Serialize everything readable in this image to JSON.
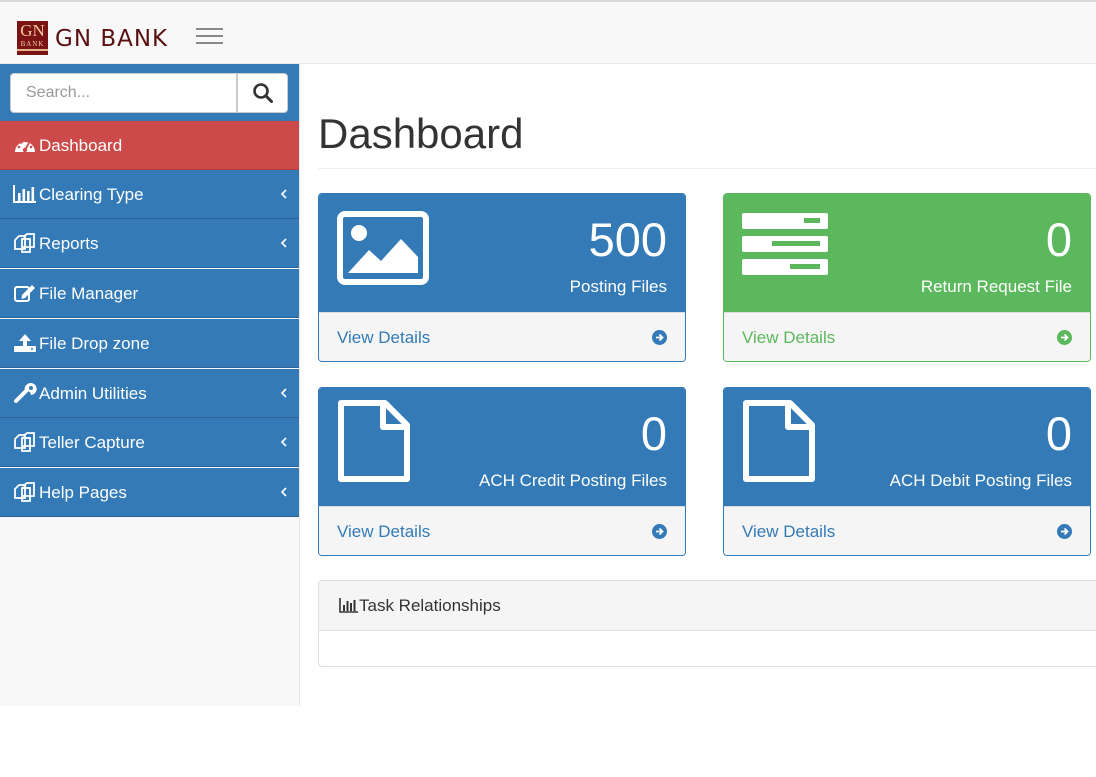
{
  "brand": {
    "logo_text": "GN",
    "logo_subtext": "BANK",
    "name": "GN BANK"
  },
  "search": {
    "placeholder": "Search..."
  },
  "sidebar": {
    "items": [
      {
        "label": "Dashboard",
        "icon": "dashboard-icon",
        "active": true
      },
      {
        "label": "Clearing Type",
        "icon": "bar-chart-icon"
      },
      {
        "label": "Reports",
        "icon": "files-icon"
      },
      {
        "label": "File Manager",
        "icon": "edit-icon"
      },
      {
        "label": "File Drop zone",
        "icon": "upload-icon"
      },
      {
        "label": "Admin Utilities",
        "icon": "wrench-icon"
      },
      {
        "label": "Teller Capture",
        "icon": "files-icon"
      },
      {
        "label": "Help Pages",
        "icon": "files-icon"
      }
    ]
  },
  "page": {
    "title": "Dashboard"
  },
  "panels": [
    {
      "count": "500",
      "caption": "Posting Files",
      "link": "View Details",
      "icon": "image-icon",
      "color": "#337ab7"
    },
    {
      "count": "0",
      "caption": "Return Request File",
      "link": "View Details",
      "icon": "server-icon",
      "color": "#5cb85c"
    },
    {
      "count": "0",
      "caption": "ACH Credit Posting Files",
      "link": "View Details",
      "icon": "file-icon",
      "color": "#337ab7"
    },
    {
      "count": "0",
      "caption": "ACH Debit Posting Files",
      "link": "View Details",
      "icon": "file-icon",
      "color": "#337ab7"
    }
  ],
  "task_panel": {
    "title": "Task Relationships",
    "icon": "bar-chart-icon"
  },
  "colors": {
    "primary": "#337ab7",
    "success": "#5cb85c",
    "active": "#cc4a4a"
  }
}
